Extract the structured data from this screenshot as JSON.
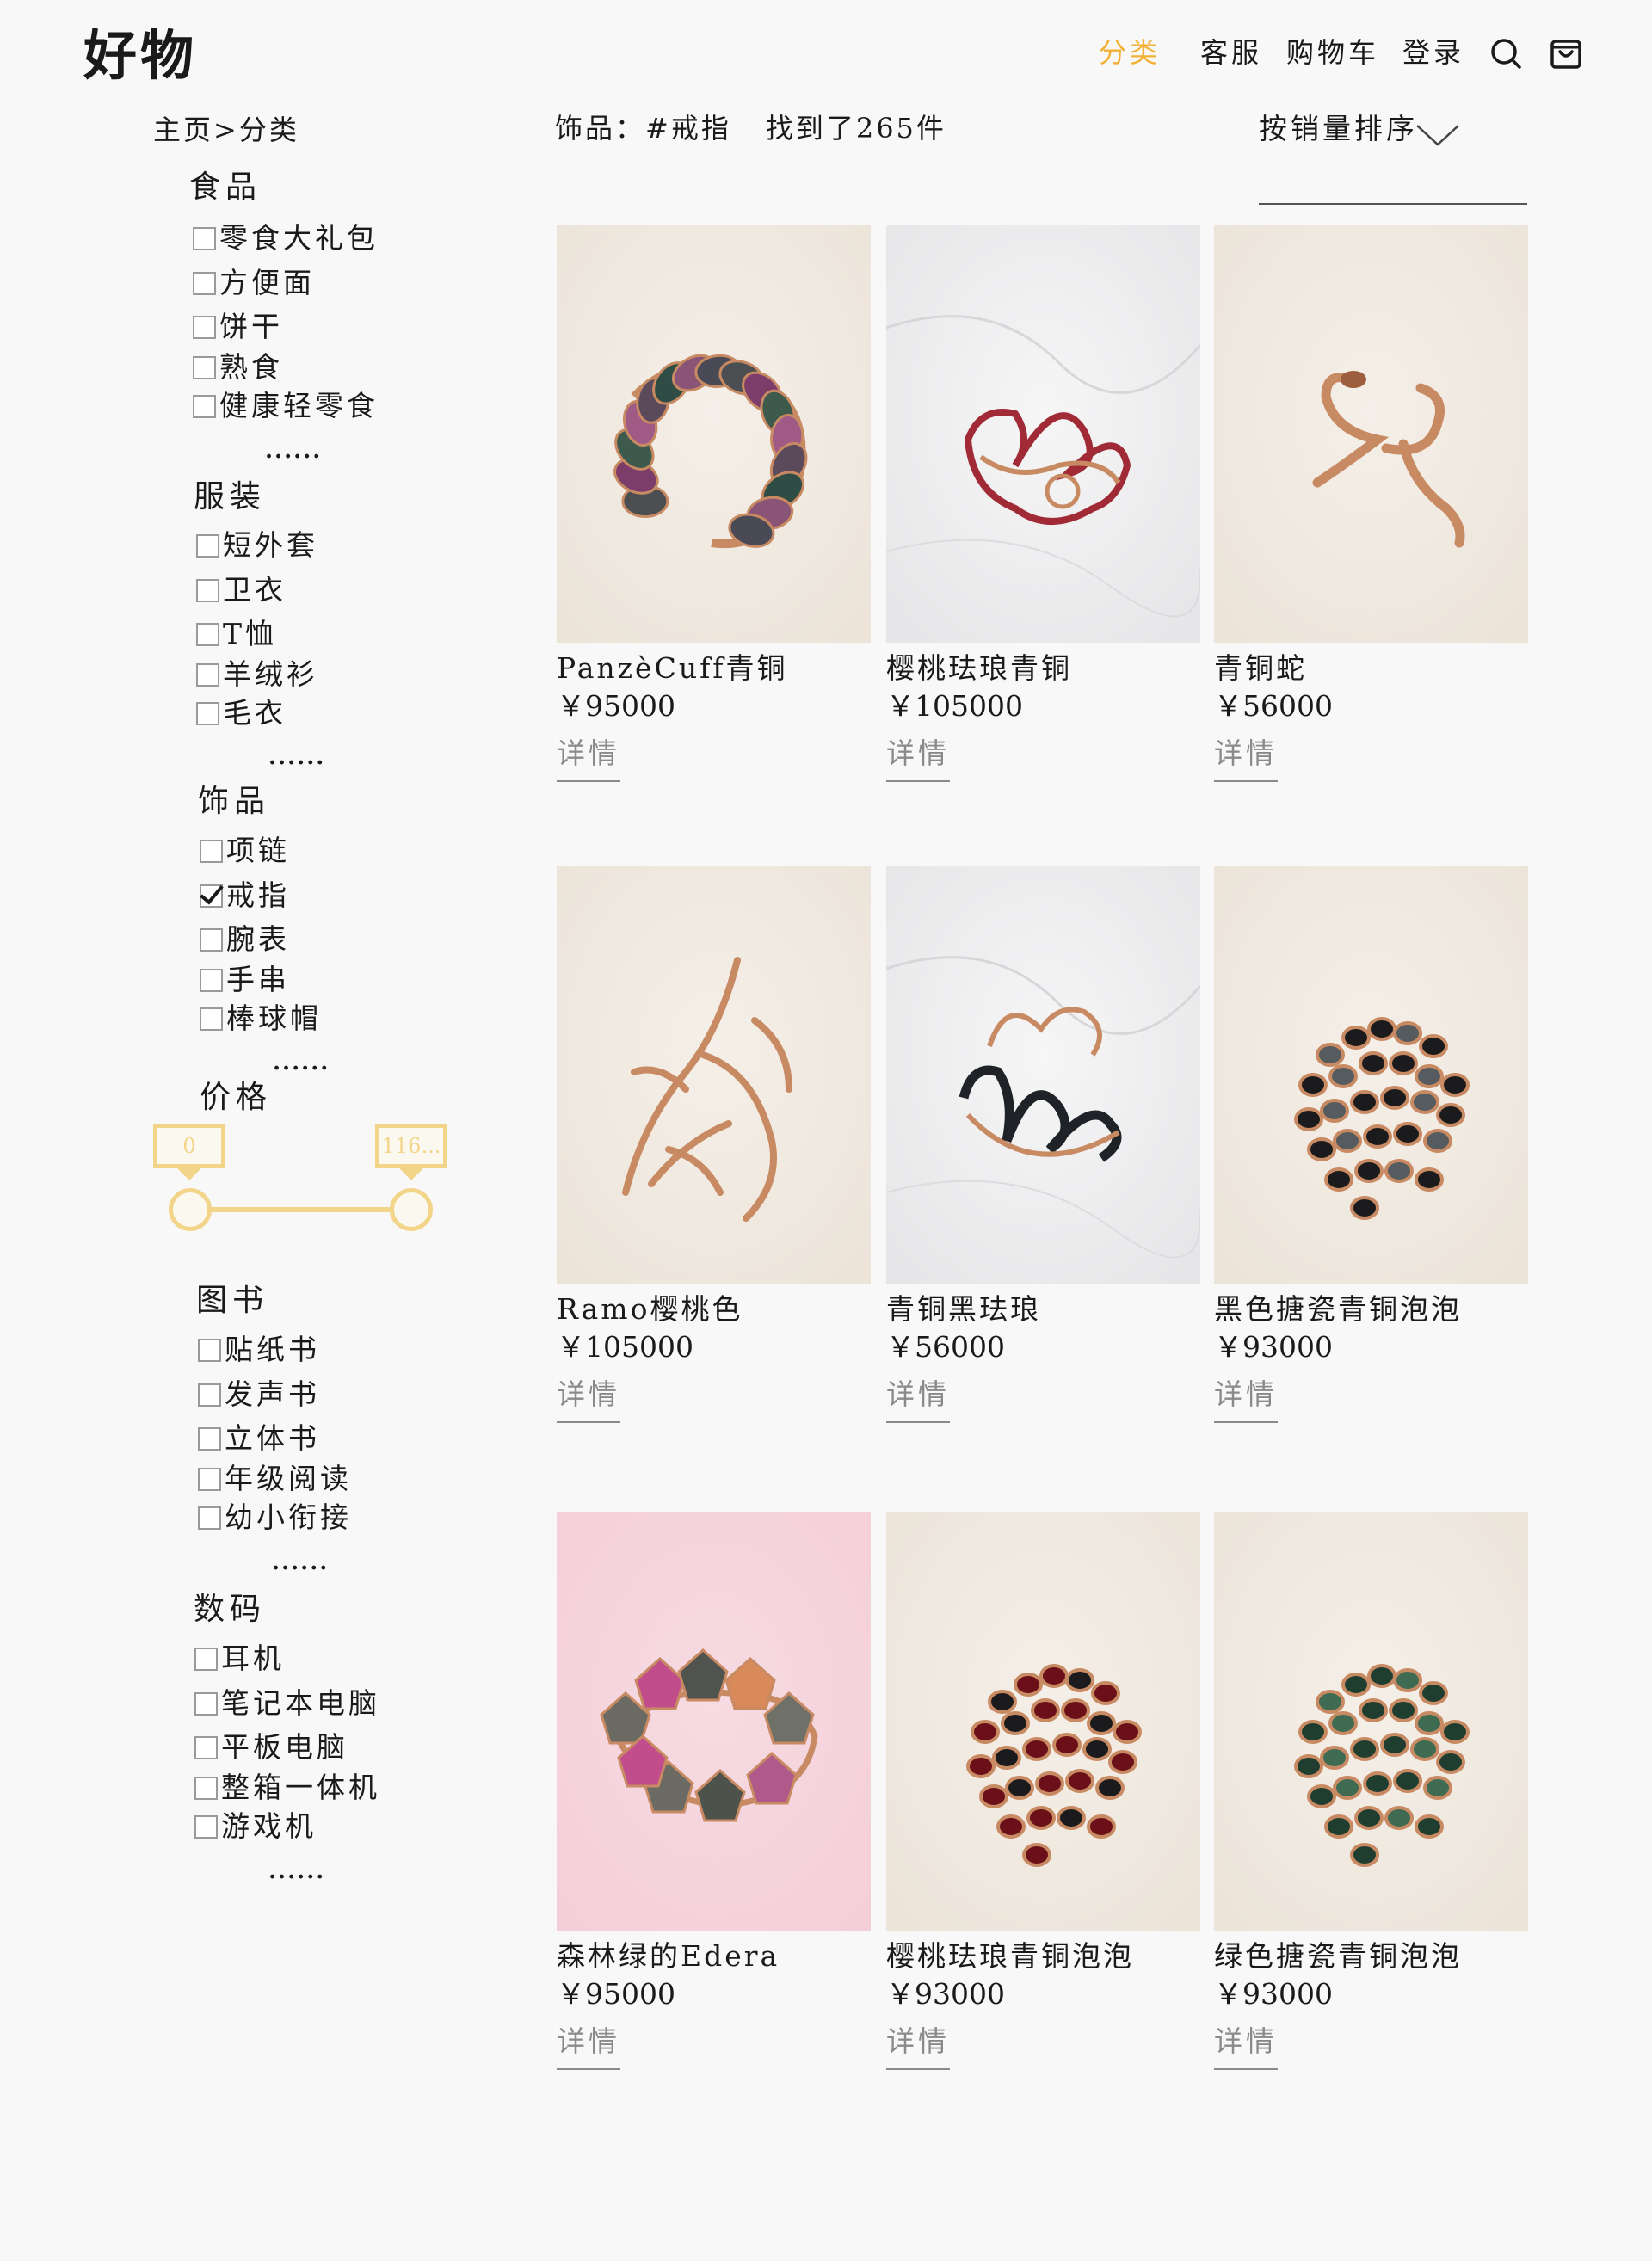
{
  "header": {
    "logo": "好物",
    "nav": [
      {
        "label": "分类",
        "active": true
      },
      {
        "label": "客服",
        "active": false
      },
      {
        "label": "购物车",
        "active": false
      },
      {
        "label": "登录",
        "active": false
      }
    ],
    "icons": [
      "search-icon",
      "shopping-bag-icon"
    ],
    "accent_color": "#f2b134"
  },
  "breadcrumb": "主页>分类",
  "results": {
    "filter": "饰品：#戒指",
    "count_text": "找到了265件"
  },
  "sort": {
    "label": "按销量排序",
    "icon": "chevron-down-icon"
  },
  "sidebar": {
    "categories": [
      {
        "title": "食品",
        "items": [
          {
            "label": "零食大礼包",
            "checked": false
          },
          {
            "label": "方便面",
            "checked": false
          },
          {
            "label": "饼干",
            "checked": false
          },
          {
            "label": "熟食",
            "checked": false
          },
          {
            "label": "健康轻零食",
            "checked": false
          }
        ],
        "more": "......"
      },
      {
        "title": "服装",
        "items": [
          {
            "label": "短外套",
            "checked": false
          },
          {
            "label": "卫衣",
            "checked": false
          },
          {
            "label": "T恤",
            "checked": false
          },
          {
            "label": "羊绒衫",
            "checked": false
          },
          {
            "label": "毛衣",
            "checked": false
          }
        ],
        "more": "......"
      },
      {
        "title": "饰品",
        "items": [
          {
            "label": "项链",
            "checked": false
          },
          {
            "label": "戒指",
            "checked": true
          },
          {
            "label": "腕表",
            "checked": false
          },
          {
            "label": "手串",
            "checked": false
          },
          {
            "label": "棒球帽",
            "checked": false
          }
        ],
        "more": "......"
      },
      {
        "title": "图书",
        "items": [
          {
            "label": "贴纸书",
            "checked": false
          },
          {
            "label": "发声书",
            "checked": false
          },
          {
            "label": "立体书",
            "checked": false
          },
          {
            "label": "年级阅读",
            "checked": false
          },
          {
            "label": "幼小衔接",
            "checked": false
          }
        ],
        "more": "......"
      },
      {
        "title": "数码",
        "items": [
          {
            "label": "耳机",
            "checked": false
          },
          {
            "label": "笔记本电脑",
            "checked": false
          },
          {
            "label": "平板电脑",
            "checked": false
          },
          {
            "label": "整箱一体机",
            "checked": false
          },
          {
            "label": "游戏机",
            "checked": false
          }
        ],
        "more": "......"
      }
    ],
    "price": {
      "title": "价格",
      "min": "0",
      "max": "116...",
      "accent_color": "#f3d58a"
    }
  },
  "products": [
    {
      "name": "PanzèCuff青铜",
      "price": "￥95000",
      "detail": "详情",
      "image": "ring-multicolor-enamel-leaves"
    },
    {
      "name": "樱桃珐琅青铜",
      "price": "￥105000",
      "detail": "详情",
      "image": "ring-red-enamel-wire"
    },
    {
      "name": "青铜蛇",
      "price": "￥56000",
      "detail": "详情",
      "image": "ring-bronze-snake"
    },
    {
      "name": "Ramo樱桃色",
      "price": "￥105000",
      "detail": "详情",
      "image": "ring-bronze-branch"
    },
    {
      "name": "青铜黑珐琅",
      "price": "￥56000",
      "detail": "详情",
      "image": "ring-black-enamel-wire"
    },
    {
      "name": "黑色搪瓷青铜泡泡",
      "price": "￥93000",
      "detail": "详情",
      "image": "ring-black-enamel-bubbles"
    },
    {
      "name": "森林绿的Edera",
      "price": "￥95000",
      "detail": "详情",
      "image": "ring-green-ivy-on-pink"
    },
    {
      "name": "樱桃珐琅青铜泡泡",
      "price": "￥93000",
      "detail": "详情",
      "image": "ring-red-enamel-bubbles"
    },
    {
      "name": "绿色搪瓷青铜泡泡",
      "price": "￥93000",
      "detail": "详情",
      "image": "ring-green-enamel-bubbles"
    }
  ]
}
